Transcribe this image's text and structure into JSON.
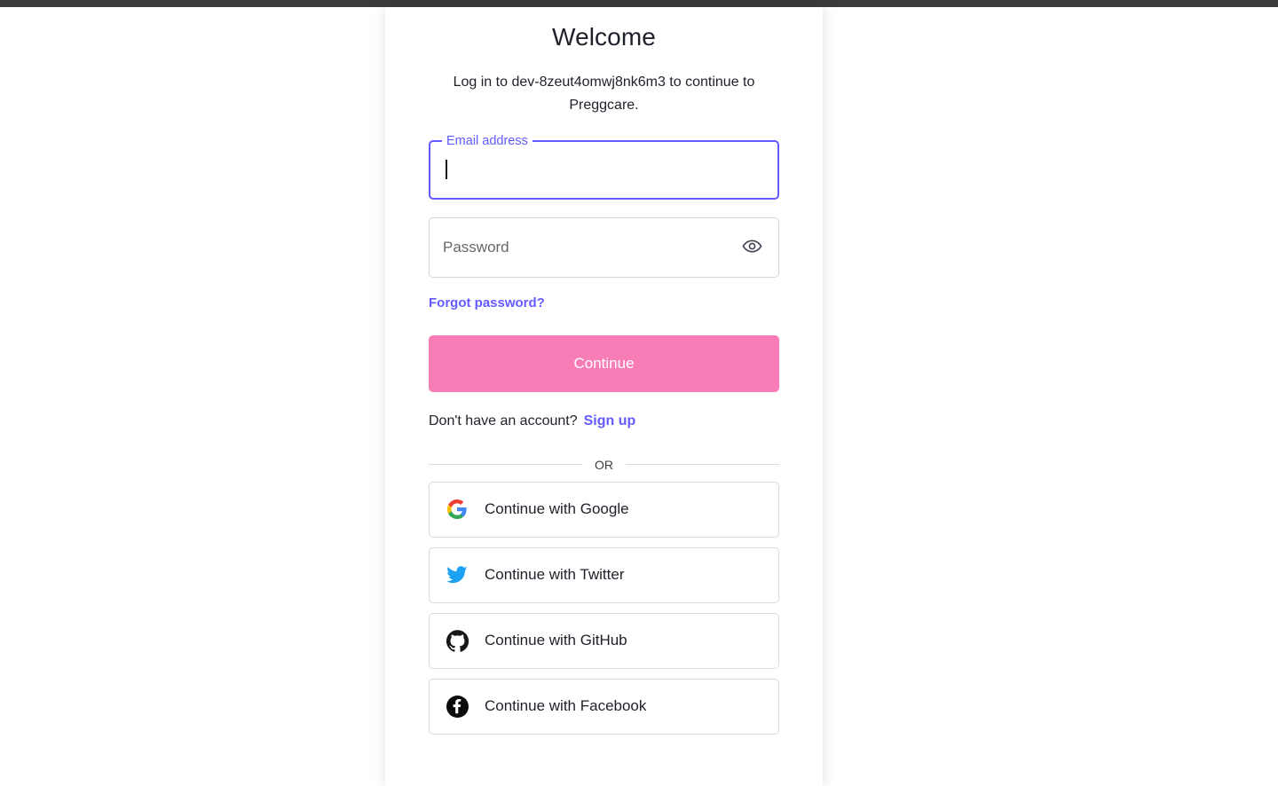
{
  "window": {
    "chrome_bar_color": "#3b3b3b",
    "page_background": "#ffffff"
  },
  "card": {
    "title": "Welcome",
    "subtitle": "Log in to dev-8zeut4omwj8nk6m3 to continue to Preggcare.",
    "tenant": "dev-8zeut4omwj8nk6m3",
    "application": "Preggcare"
  },
  "form": {
    "email": {
      "label": "Email address",
      "value": "",
      "placeholder": "",
      "focused": true
    },
    "password": {
      "label": "Password",
      "value": "",
      "placeholder": "Password",
      "toggle_icon": "eye-icon",
      "focused": false
    },
    "forgot_password_label": "Forgot password?",
    "submit_label": "Continue"
  },
  "signup": {
    "prompt": "Don't have an account?",
    "link_label": "Sign up"
  },
  "divider": {
    "label": "OR"
  },
  "social": {
    "buttons": [
      {
        "label": "Continue with Google",
        "icon": "google-icon"
      },
      {
        "label": "Continue with Twitter",
        "icon": "twitter-icon"
      },
      {
        "label": "Continue with GitHub",
        "icon": "github-icon"
      },
      {
        "label": "Continue with Facebook",
        "icon": "facebook-icon"
      }
    ]
  },
  "colors": {
    "accent_purple": "#635bff",
    "primary_pink": "#f87cb6",
    "text_dark": "#1e212a",
    "border_grey": "#d9dade",
    "placeholder_grey": "#65676e",
    "google_blue": "#4285f4",
    "google_red": "#ea4335",
    "google_yellow": "#fbbc05",
    "google_green": "#34a853",
    "twitter_blue": "#1da1f2",
    "github_black": "#181717",
    "facebook_black": "#0b0b0b"
  }
}
